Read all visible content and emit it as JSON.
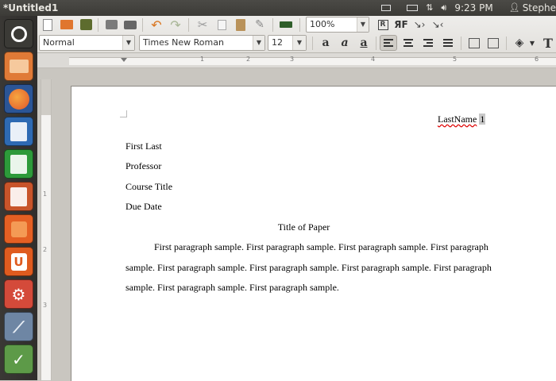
{
  "topbar": {
    "window_title": "*Untitled1",
    "time": "9:23 PM",
    "user": "Stephe"
  },
  "toolbar": {
    "zoom": "100%"
  },
  "format_bar": {
    "style": "Normal",
    "font": "Times New Roman",
    "size": "12"
  },
  "document": {
    "header_name": "LastName",
    "header_page": "1",
    "lines": [
      "First Last",
      "Professor",
      "Course Title",
      "Due Date"
    ],
    "title": "Title of Paper",
    "paragraph_lines": [
      "First paragraph sample. First paragraph sample. First paragraph sample. First paragraph",
      "sample. First paragraph sample. First paragraph sample. First paragraph sample. First paragraph",
      "sample. First paragraph sample. First paragraph sample."
    ]
  },
  "ruler": {
    "h_numbers": [
      "1",
      "2",
      "3",
      "4",
      "5",
      "6"
    ],
    "v_numbers": [
      "1",
      "2",
      "3"
    ]
  },
  "colors": {
    "launcher_dash": "#3b3a36",
    "launcher_files": "#e07a37",
    "launcher_firefox": "#e2562a",
    "launcher_writer": "#2e6ab3",
    "launcher_calc": "#2d9a3a",
    "launcher_impress": "#c8542a",
    "launcher_software": "#e45f23",
    "launcher_ubuntuone": "#df5b1f",
    "launcher_settings": "#d44a3a",
    "launcher_app1": "#6e86a4",
    "launcher_app2": "#5d9a48"
  }
}
